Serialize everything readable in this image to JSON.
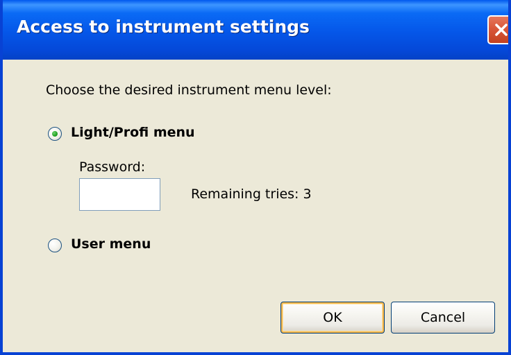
{
  "window": {
    "title": "Access to instrument settings",
    "close_icon": "close-icon"
  },
  "dialog": {
    "prompt": "Choose the desired instrument menu level:",
    "options": [
      {
        "label": "Light/Profi menu",
        "selected": true
      },
      {
        "label": "User menu",
        "selected": false
      }
    ],
    "password": {
      "label": "Password:",
      "value": "",
      "placeholder": ""
    },
    "remaining_tries": "Remaining tries: 3"
  },
  "buttons": {
    "ok_label": "OK",
    "cancel_label": "Cancel"
  },
  "colors": {
    "titlebar_blue": "#0556E8",
    "dialog_bg": "#ECE9D8",
    "close_red": "#D9573A",
    "radio_green": "#21A121",
    "default_button_glow": "#F8B84A"
  }
}
